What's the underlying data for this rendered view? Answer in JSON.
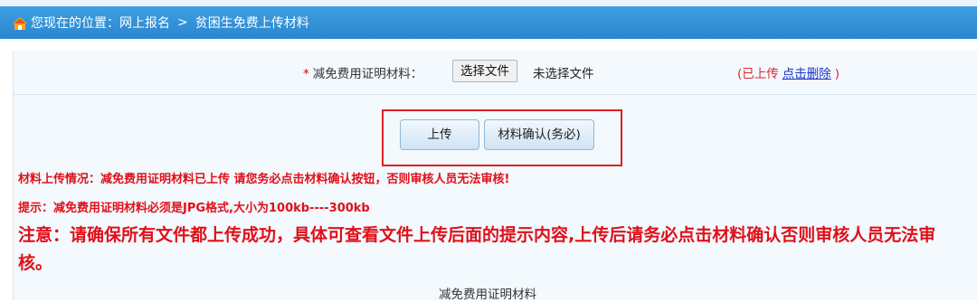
{
  "header": {
    "location_prefix": "您现在的位置：",
    "crumb1": "网上报名",
    "separator": ">",
    "crumb2": "贫困生免费上传材料"
  },
  "form": {
    "required_mark": "*",
    "field_label": "减免费用证明材料：",
    "file_button_label": "选择文件",
    "file_status": "未选择文件",
    "uploaded_prefix": "(已上传",
    "delete_link": "点击删除",
    "uploaded_suffix": ")"
  },
  "buttons": {
    "upload_label": "上传",
    "confirm_label": "材料确认(务必)"
  },
  "messages": {
    "status": "材料上传情况：减免费用证明材料已上传 请您务必点击材料确认按钮，否则审核人员无法审核!",
    "hint": "提示：减免费用证明材料必须是JPG格式,大小为100kb----300kb",
    "note": "注意：请确保所有文件都上传成功，具体可查看文件上传后面的提示内容,上传后请务必点击材料确认否则审核人员无法审核。"
  },
  "footer": {
    "section_label": "减免费用证明材料"
  },
  "icons": {
    "home": "home-icon"
  },
  "colors": {
    "header": "#2a86cf",
    "alert_red": "#e0101a",
    "link_blue": "#1a32c8"
  }
}
